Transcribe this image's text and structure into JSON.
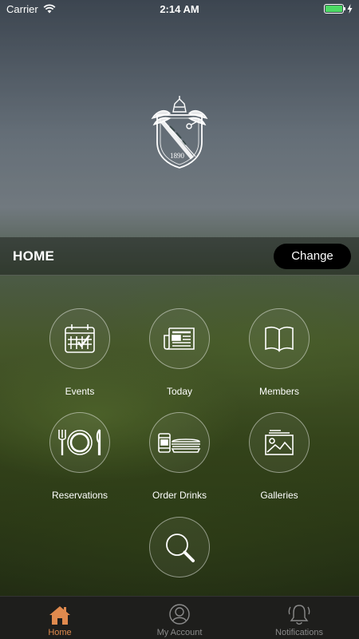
{
  "status_bar": {
    "carrier": "Carrier",
    "time": "2:14 AM",
    "battery_color": "#4cd964"
  },
  "crest": {
    "year": "1890"
  },
  "header": {
    "title": "HOME",
    "change_label": "Change"
  },
  "grid": {
    "items": [
      {
        "label": "Events",
        "icon": "calendar-icon"
      },
      {
        "label": "Today",
        "icon": "newspaper-icon"
      },
      {
        "label": "Members",
        "icon": "book-icon"
      },
      {
        "label": "Reservations",
        "icon": "plate-cutlery-icon"
      },
      {
        "label": "Order Drinks",
        "icon": "drinks-food-icon"
      },
      {
        "label": "Galleries",
        "icon": "gallery-icon"
      },
      {
        "label": "",
        "icon": "search-icon"
      }
    ]
  },
  "tab_bar": {
    "tabs": [
      {
        "label": "Home",
        "icon": "home-icon",
        "active": true
      },
      {
        "label": "My Account",
        "icon": "account-icon",
        "active": false
      },
      {
        "label": "Notifications",
        "icon": "bell-icon",
        "active": false
      }
    ],
    "active_color": "#e08a4e"
  }
}
